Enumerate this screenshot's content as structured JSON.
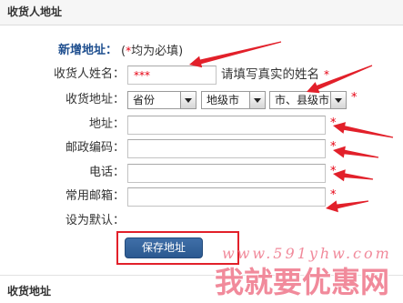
{
  "section_header": {
    "title": "收货人地址"
  },
  "form": {
    "heading": "新增地址：",
    "note": {
      "open": "(",
      "text": "均为必填)"
    },
    "required_mark": "*",
    "name": {
      "label": "收货人姓名：",
      "value": "***",
      "hint": "请填写真实的姓名"
    },
    "region": {
      "label": "收货地址：",
      "province": "省份",
      "city": "地级市",
      "county": "市、县级市"
    },
    "address": {
      "label": "地址："
    },
    "postcode": {
      "label": "邮政编码："
    },
    "phone": {
      "label": "电话："
    },
    "email": {
      "label": "常用邮箱："
    },
    "default": {
      "label": "设为默认："
    },
    "save_button": "保存地址"
  },
  "address_list": {
    "title": "收货地址"
  },
  "watermark": {
    "url": "www.591yhw.com",
    "text": "我就要优惠网"
  },
  "icons": {
    "select_arrow": "triangle-down-icon"
  },
  "colors": {
    "heading": "#1f4f8f",
    "required": "#e60012",
    "button": "#2b5990",
    "annotation": "#e2202a",
    "watermark": "#f18a9b"
  }
}
